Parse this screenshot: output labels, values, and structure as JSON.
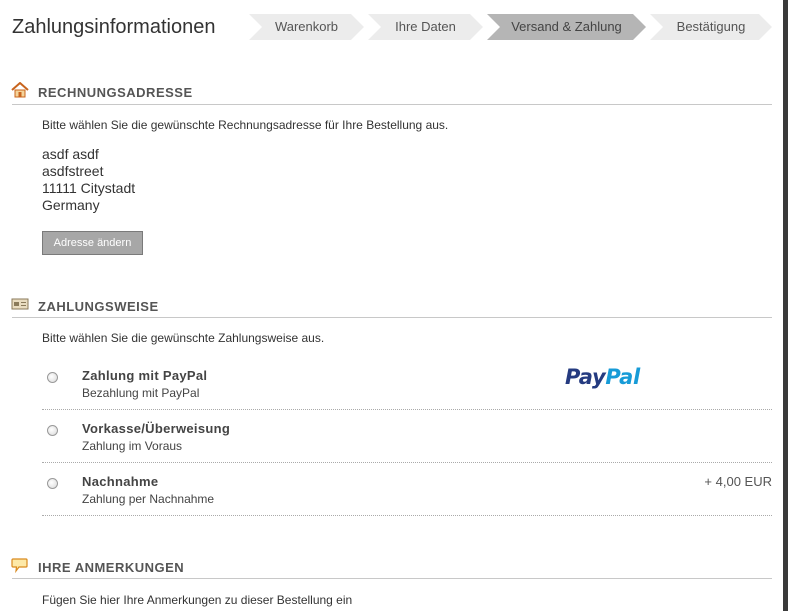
{
  "page": {
    "title": "Zahlungsinformationen"
  },
  "steps": [
    {
      "label": "Warenkorb",
      "active": false
    },
    {
      "label": "Ihre Daten",
      "active": false
    },
    {
      "label": "Versand & Zahlung",
      "active": true
    },
    {
      "label": "Bestätigung",
      "active": false
    }
  ],
  "billing": {
    "title": "RECHNUNGSADRESSE",
    "hint": "Bitte wählen Sie die gewünschte Rechnungsadresse für Ihre Bestellung aus.",
    "address": [
      "asdf asdf",
      "asdfstreet",
      "11111 Citystadt",
      "Germany"
    ],
    "change_button": "Adresse ändern"
  },
  "payment": {
    "title": "ZAHLUNGSWEISE",
    "hint": "Bitte wählen Sie die gewünschte Zahlungsweise aus.",
    "methods": [
      {
        "name": "Zahlung mit PayPal",
        "description": "Bezahlung mit PayPal",
        "logo": "paypal-logo",
        "fee": ""
      },
      {
        "name": "Vorkasse/Überweisung",
        "description": "Zahlung im Voraus",
        "fee": ""
      },
      {
        "name": "Nachnahme",
        "description": "Zahlung per Nachnahme",
        "fee": "+ 4,00 EUR"
      }
    ],
    "paypal_logo_text": [
      "Pay",
      "Pal"
    ]
  },
  "comments": {
    "title": "IHRE ANMERKUNGEN",
    "hint": "Fügen Sie hier Ihre Anmerkungen zu dieser Bestellung ein"
  },
  "colors": {
    "step_inactive": "#ececec",
    "step_active": "#b5b5b5",
    "paypal_dark": "#253b80",
    "paypal_light": "#179bd7",
    "button_bg": "#a7a7a7"
  }
}
